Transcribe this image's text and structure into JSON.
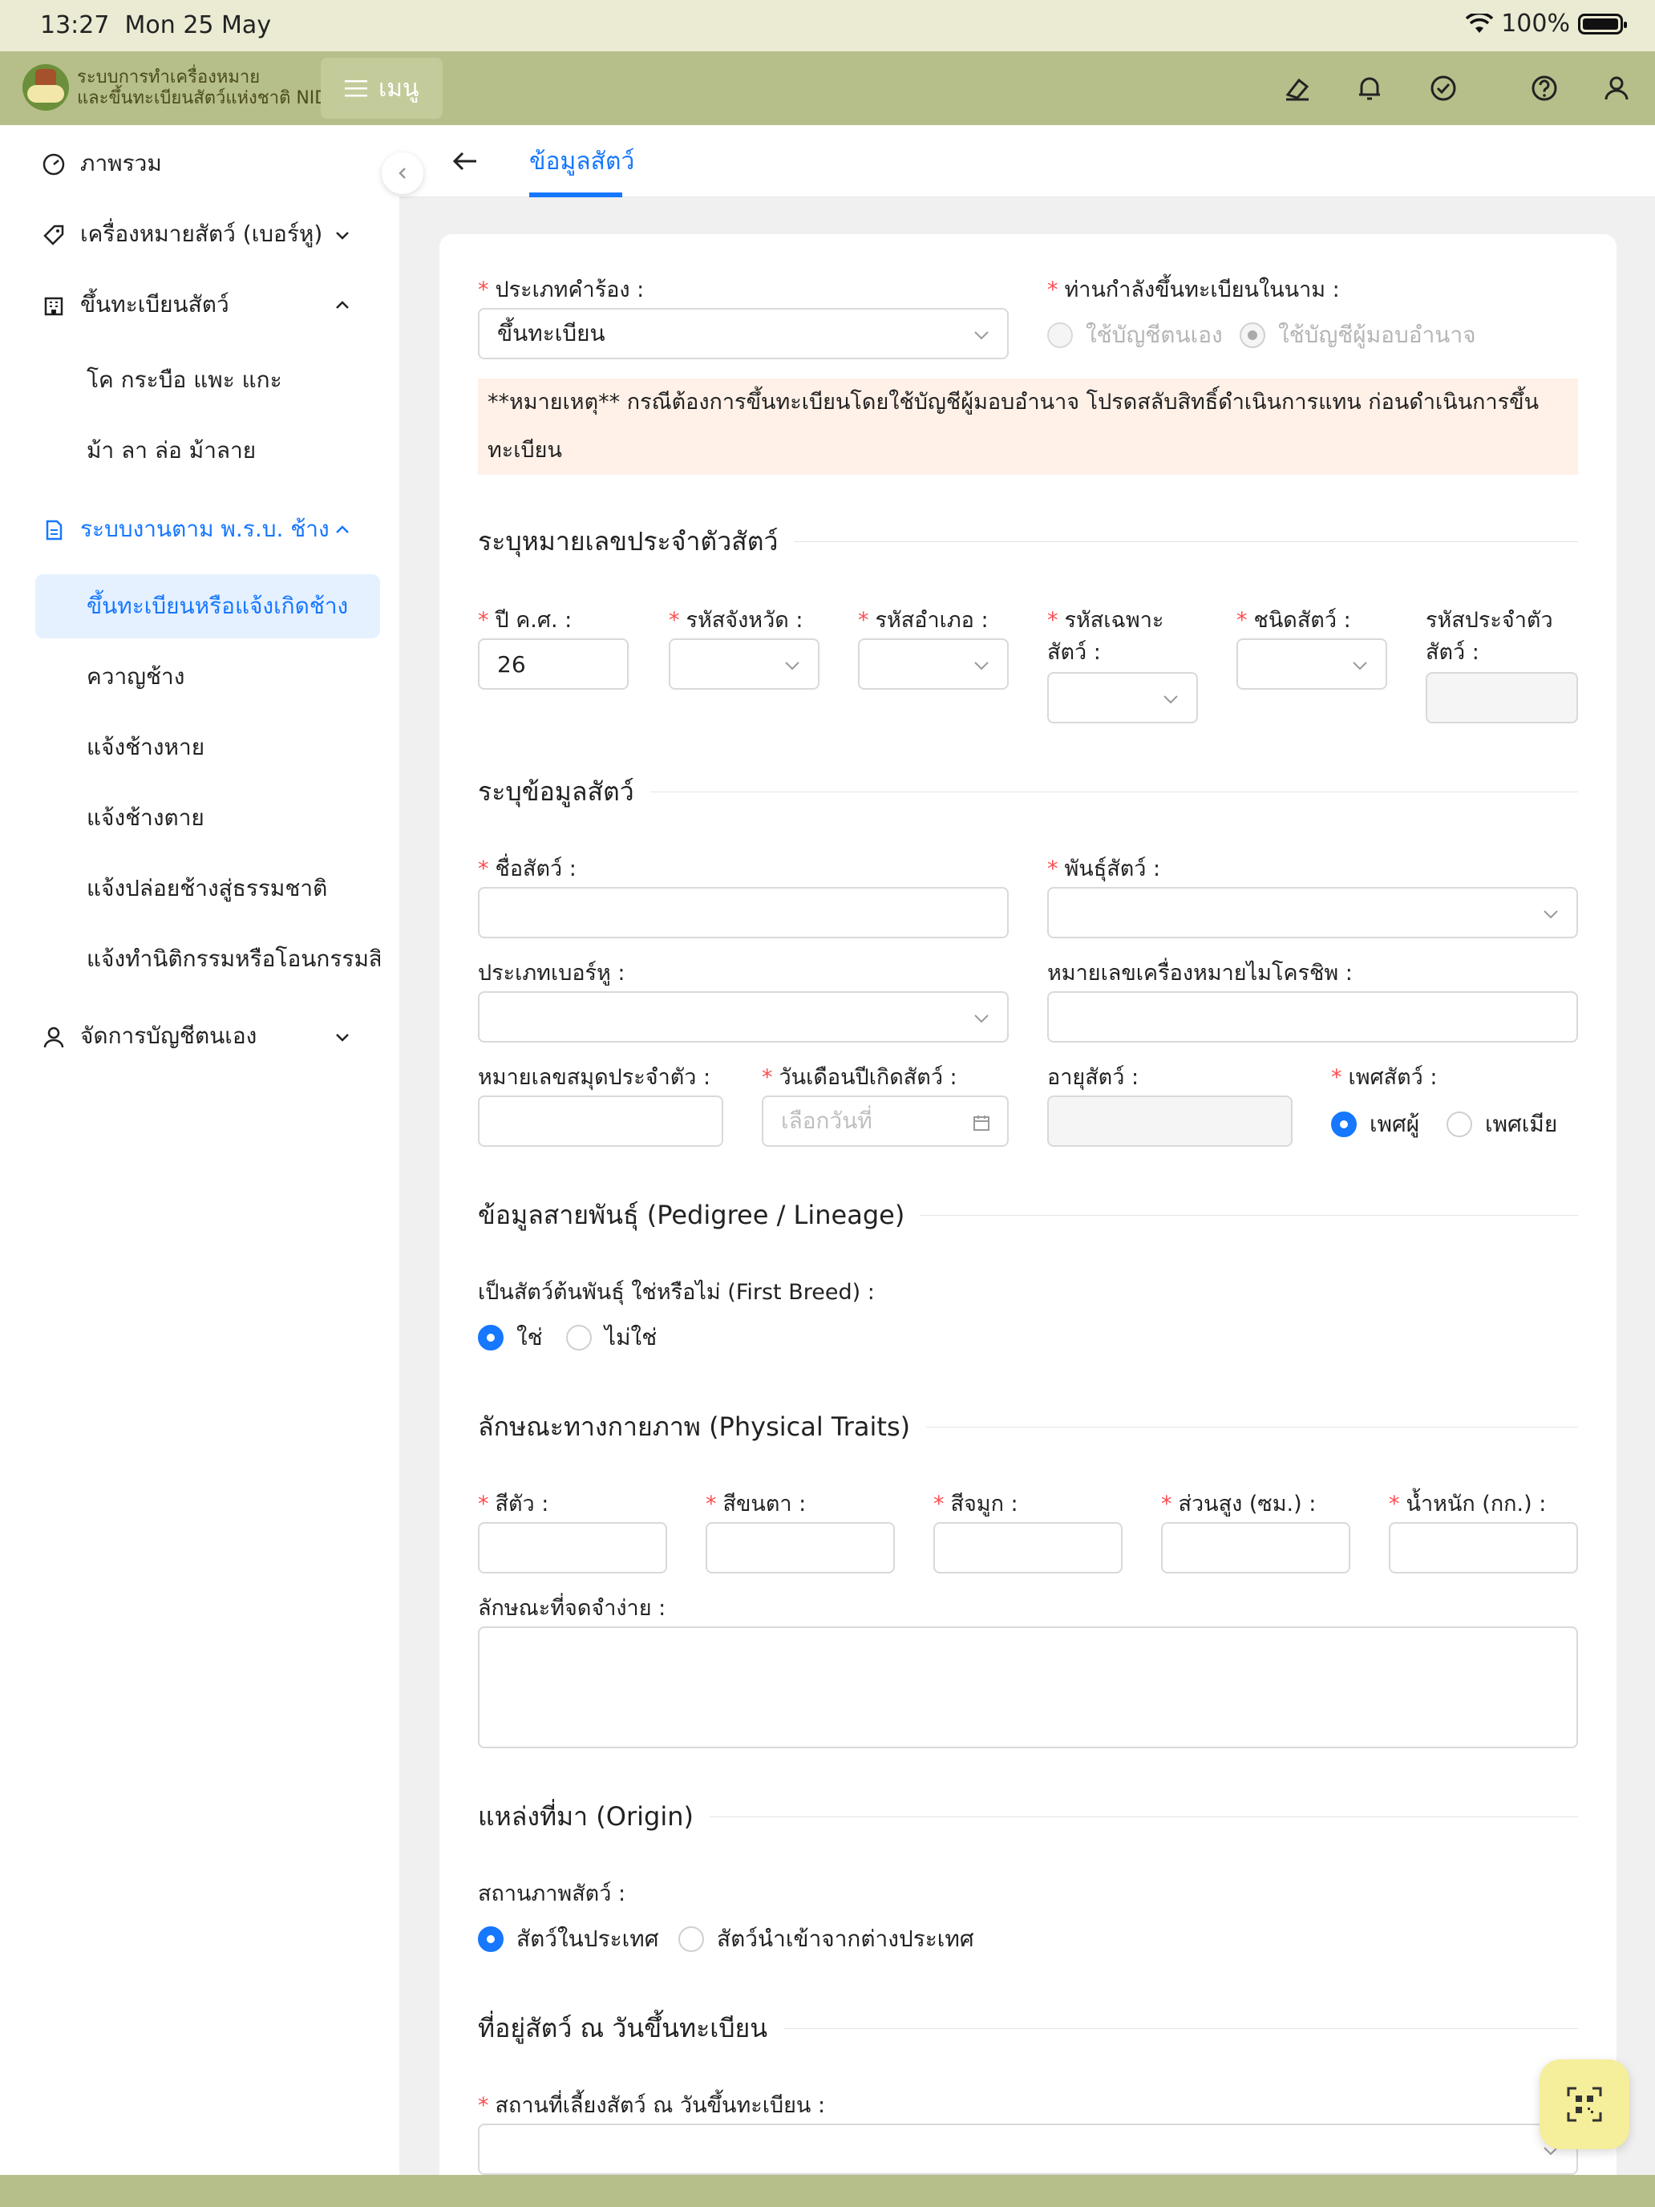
{
  "status": {
    "time": "13:27",
    "date": "Mon 25 May",
    "battery": "100%"
  },
  "header": {
    "logo_line1": "ระบบการทำเครื่องหมาย",
    "logo_line2": "และขึ้นทะเบียนสัตว์แห่งชาติ NID",
    "menu": "เมนู"
  },
  "sidebar": {
    "overview": "ภาพรวม",
    "tags": "เครื่องหมายสัตว์ (เบอร์หู)",
    "register": "ขึ้นทะเบียนสัตว์",
    "register_sub": [
      "โค กระบือ แพะ แกะ",
      "ม้า ลา ล่อ ม้าลาย"
    ],
    "elephant": "ระบบงานตาม พ.ร.บ. ช้าง",
    "elephant_sub": [
      "ขึ้นทะเบียนหรือแจ้งเกิดช้าง",
      "ควาญช้าง",
      "แจ้งช้างหาย",
      "แจ้งช้างตาย",
      "แจ้งปล่อยช้างสู่ธรรมชาติ",
      "แจ้งทำนิติกรรมหรือโอนกรรมสิทธิ์"
    ],
    "account": "จัดการบัญชีตนเอง"
  },
  "page": {
    "tab": "ข้อมูลสัตว์"
  },
  "form": {
    "request_type_label": "ประเภทคำร้อง :",
    "request_type_value": "ขึ้นทะเบียน",
    "register_in_name_label": "ท่านกำลังขึ้นทะเบียนในนาม :",
    "opt_own": "ใช้บัญชีตนเอง",
    "opt_delegate": "ใช้บัญชีผู้มอบอำนาจ",
    "note_line1": "**หมายเหตุ** กรณีต้องการขึ้นทะเบียนโดยใช้บัญชีผู้มอบอำนาจ โปรดสลับสิทธิ์ดำเนินการแทน ก่อนดำเนินการขึ้น",
    "note_line2": "ทะเบียน",
    "sect_id": "ระบุหมายเลขประจำตัวสัตว์",
    "year_label": "ปี ค.ศ. :",
    "year_value": "26",
    "province_label": "รหัสจังหวัด :",
    "district_label": "รหัสอำเภอ :",
    "specific_label_1": "รหัสเฉพาะ",
    "specific_label_2": "สัตว์ :",
    "species_label": "ชนิดสัตว์ :",
    "animal_id_label_1": "รหัสประจำตัว",
    "animal_id_label_2": "สัตว์ :",
    "sect_info": "ระบุข้อมูลสัตว์",
    "name_label": "ชื่อสัตว์ :",
    "breed_label": "พันธุ์สัตว์ :",
    "ear_type_label": "ประเภทเบอร์หู :",
    "microchip_label": "หมายเลขเครื่องหมายไมโครชิพ :",
    "book_label": "หมายเลขสมุดประจำตัว :",
    "dob_label": "วันเดือนปีเกิดสัตว์ :",
    "dob_placeholder": "เลือกวันที่",
    "age_label": "อายุสัตว์ :",
    "sex_label": "เพศสัตว์ :",
    "male": "เพศผู้",
    "female": "เพศเมีย",
    "sect_pedigree": "ข้อมูลสายพันธุ์ (Pedigree / Lineage)",
    "first_breed_label": "เป็นสัตว์ต้นพันธุ์ ใช่หรือไม่ (First Breed) :",
    "yes": "ใช่",
    "no": "ไม่ใช่",
    "sect_physical": "ลักษณะทางกายภาพ (Physical Traits)",
    "body_color": "สีตัว :",
    "eye_color": "สีขนตา :",
    "nose_color": "สีจมูก :",
    "height": "ส่วนสูง (ซม.) :",
    "weight": "น้ำหนัก (กก.) :",
    "marks_label": "ลักษณะที่จดจำง่าย :",
    "sect_origin": "แหล่งที่มา (Origin)",
    "status_label": "สถานภาพสัตว์ :",
    "domestic": "สัตว์ในประเทศ",
    "imported": "สัตว์นำเข้าจากต่างประเทศ",
    "sect_address": "ที่อยู่สัตว์ ณ วันขึ้นทะเบียน",
    "place_label": "สถานที่เลี้ยงสัตว์ ณ วันขึ้นทะเบียน :"
  }
}
